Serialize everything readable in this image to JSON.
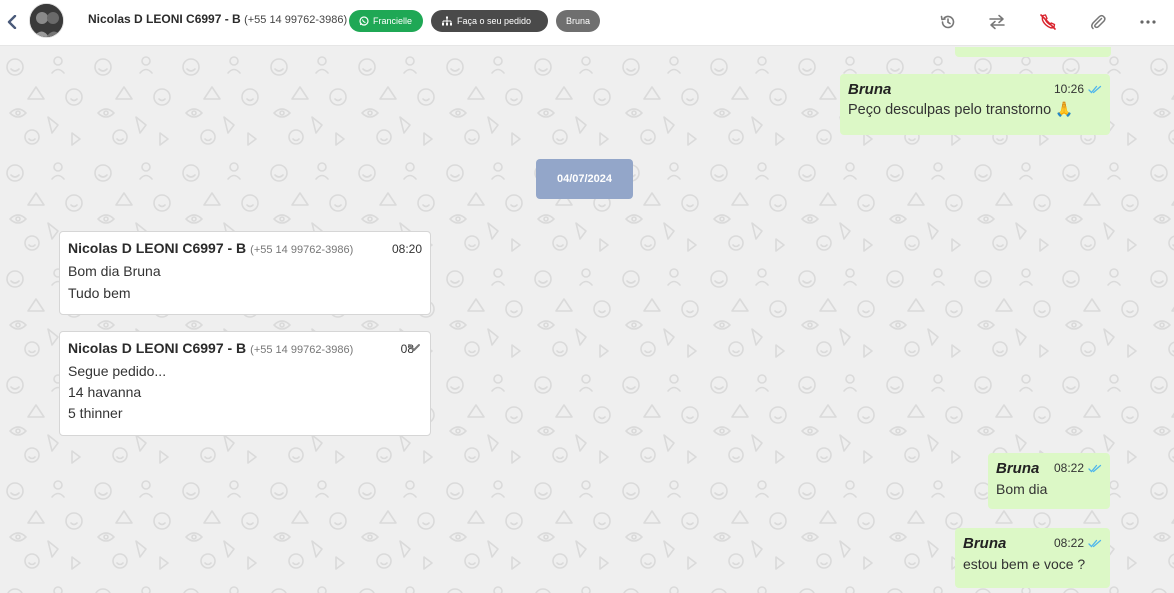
{
  "header": {
    "contact_name": "Nicolas D LEONI C6997 - B",
    "contact_phone": "(+55 14 99762-3986)",
    "chips": [
      {
        "label": "Francielle",
        "color": "#1fa855",
        "icon": "whatsapp-icon"
      },
      {
        "label": "Faça o seu pedido",
        "color": "#4a4a4a",
        "icon": "sitemap-icon"
      },
      {
        "label": "Bruna",
        "color": "#6f6f6f"
      }
    ],
    "actions": [
      "history-icon",
      "transfer-icon",
      "end-call-icon",
      "attachment-icon",
      "more-icon"
    ]
  },
  "date_separator": "04/07/2024",
  "messages": [
    {
      "direction": "out",
      "sender": "Bruna",
      "time": "10:26",
      "text": "Peço desculpas pelo transtorno 🙏"
    },
    {
      "direction": "in",
      "sender": "Nicolas D LEONI C6997 - B",
      "phone": "(+55 14 99762-3986)",
      "time": "08:20",
      "lines": [
        "Bom dia Bruna",
        "Tudo bem"
      ]
    },
    {
      "direction": "in",
      "sender": "Nicolas D LEONI C6997 - B",
      "phone": "(+55 14 99762-3986)",
      "time": "08",
      "lines": [
        "Segue pedido...",
        "14 havanna",
        "5 thinner"
      ]
    },
    {
      "direction": "out",
      "sender": "Bruna",
      "time": "08:22",
      "text": "Bom dia"
    },
    {
      "direction": "out",
      "sender": "Bruna",
      "time": "08:22",
      "text": "estou bem e voce ?"
    }
  ],
  "colors": {
    "outgoing_bubble": "#dcf8c6",
    "incoming_bubble": "#ffffff",
    "read_ticks": "#4fb6ec",
    "date_pill": "#93a6c9"
  }
}
